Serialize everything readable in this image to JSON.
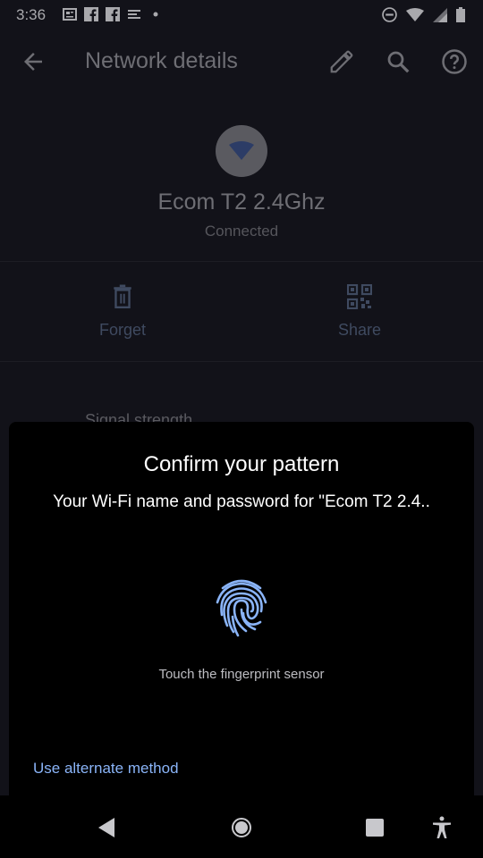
{
  "status_bar": {
    "time": "3:36",
    "left_icons": [
      "news-icon",
      "facebook-icon",
      "facebook-icon",
      "list-icon",
      "dot-icon"
    ],
    "right_icons": [
      "do-not-disturb-icon",
      "wifi-icon",
      "cell-signal-icon",
      "battery-icon"
    ]
  },
  "app_bar": {
    "title": "Network details",
    "icons": [
      "back-arrow-icon",
      "edit-icon",
      "search-icon",
      "help-icon"
    ]
  },
  "network": {
    "name": "Ecom T2 2.4Ghz",
    "status": "Connected"
  },
  "actions": [
    {
      "label": "Forget",
      "icon": "trash-icon"
    },
    {
      "label": "Share",
      "icon": "qr-code-icon"
    }
  ],
  "details": {
    "signal_label": "Signal strength"
  },
  "dialog": {
    "title": "Confirm your pattern",
    "subtitle": "Your Wi-Fi name and password for \"Ecom T2 2.4..",
    "hint": "Touch the fingerprint sensor",
    "alt_method": "Use alternate method",
    "accent": "#8ab4f8"
  },
  "nav_bar": {
    "icons": [
      "back-triangle-icon",
      "home-circle-icon",
      "recents-square-icon",
      "accessibility-icon"
    ]
  }
}
